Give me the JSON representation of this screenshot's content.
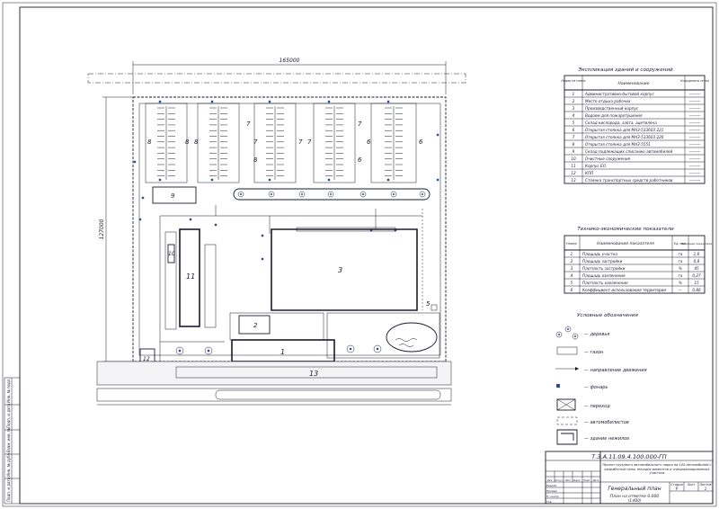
{
  "dimensions": {
    "width": "165000",
    "height": "127000"
  },
  "explication": {
    "title": "Экспликация зданий и сооружений",
    "headers": [
      "Номер на плане",
      "Наименование",
      "Координаты сетки"
    ],
    "rows": [
      {
        "n": "1",
        "name": "Административно-бытовой корпус",
        "c": "———"
      },
      {
        "n": "2",
        "name": "Место отдыха рабочих",
        "c": "———"
      },
      {
        "n": "3",
        "name": "Производственный корпус",
        "c": "———"
      },
      {
        "n": "4",
        "name": "Водоем для пожаротушения",
        "c": "———"
      },
      {
        "n": "5",
        "name": "Склад кислорода, азота, ацетилена",
        "c": "———"
      },
      {
        "n": "6",
        "name": "Открытая стоянка для МАЗ-533603 221",
        "c": "———"
      },
      {
        "n": "7",
        "name": "Открытая стоянка для МАЗ-533603 220",
        "c": "———"
      },
      {
        "n": "8",
        "name": "Открытая стоянка для МАЗ-5551",
        "c": "———"
      },
      {
        "n": "9",
        "name": "Склад подлежащих списанию автомобилей",
        "c": "———"
      },
      {
        "n": "10",
        "name": "Очистные сооружения",
        "c": "———"
      },
      {
        "n": "11",
        "name": "Корпус ЕО",
        "c": "———"
      },
      {
        "n": "12",
        "name": "КПП",
        "c": "———"
      },
      {
        "n": "13",
        "name": "Стоянка транспортных средств работников",
        "c": "———"
      }
    ]
  },
  "indicators": {
    "title": "Технико-экономические показатели",
    "headers": [
      "Номер",
      "Наименование показателя",
      "Ед. изм.",
      "Значение показателя"
    ],
    "rows": [
      {
        "n": "1",
        "name": "Площадь участка",
        "u": "га",
        "v": "1,6"
      },
      {
        "n": "2",
        "name": "Площадь застройки",
        "u": "га",
        "v": "0,8"
      },
      {
        "n": "3",
        "name": "Плотность застройки",
        "u": "%",
        "v": "45"
      },
      {
        "n": "4",
        "name": "Площадь озеленения",
        "u": "га",
        "v": "0,27"
      },
      {
        "n": "5",
        "name": "Плотность озеленения",
        "u": "%",
        "v": "15"
      },
      {
        "n": "6",
        "name": "Коэффициент использования территории",
        "u": "—",
        "v": "0,86"
      }
    ]
  },
  "legend": {
    "title": "Условные обозначения",
    "items": [
      "— деревья",
      "— газон",
      "— направление движения",
      "— фонарь",
      "— переход",
      "— автомобилистов",
      "— здание нежилое"
    ]
  },
  "plan_labels": {
    "b1": "1",
    "b2": "2",
    "b3": "3",
    "b5": "5",
    "b9": "9",
    "b10": "10",
    "b11": "11",
    "b12": "12",
    "b13": "13",
    "p8a": "8",
    "p8b": "8",
    "p8c": "8",
    "p8d": "8",
    "p7a": "7",
    "p7b": "7",
    "p7c": "7",
    "p7d": "7",
    "p7e": "7",
    "p6a": "6",
    "p6b": "6",
    "p6c": "6"
  },
  "title_block": {
    "code": "Т.З.А.11.09.4.100.000-ГП",
    "project": "Проект грузового автомобильного парка на 100 автомобилей с разработкой зоны текущих ремонтов и специализированных участков",
    "sheet_title": "Генеральный план",
    "subtitle": "План на отметке 0.000",
    "scale": "(1:400)",
    "stage_h": "Стадия",
    "sheet_h": "Лист",
    "sheets_h": "Листов",
    "stage": "Р",
    "sheet": "",
    "sheets": "1",
    "left_cells": [
      "Изм.",
      "Кол.уч",
      "Лист",
      "№док.",
      "Подп.",
      "Дата"
    ],
    "roles": [
      "Разраб.",
      "Провер.",
      "Н. контр.",
      "Утв."
    ]
  },
  "side_stamp": [
    "Инв. № подл.",
    "Подп. и дата",
    "Взам. инв. №",
    "Инв. № дубл.",
    "Подп. и дата"
  ]
}
